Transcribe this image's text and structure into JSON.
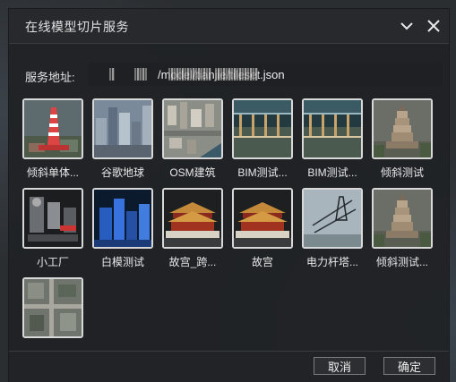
{
  "dialog": {
    "title": "在线模型切片服务",
    "collapse_icon": "chevron-down-icon",
    "close_icon": "close-icon"
  },
  "address": {
    "label": "服务地址:",
    "value": "/model/tianjie/tileset.json"
  },
  "services": [
    {
      "label": "倾斜单体...",
      "thumb": "tower-red"
    },
    {
      "label": "谷歌地球",
      "thumb": "city-blue"
    },
    {
      "label": "OSM建筑",
      "thumb": "osm-city"
    },
    {
      "label": "BIM测试...",
      "thumb": "bim-hall"
    },
    {
      "label": "BIM测试...",
      "thumb": "bim-hall"
    },
    {
      "label": "倾斜测试",
      "thumb": "pagoda"
    },
    {
      "label": "小工厂",
      "thumb": "factory"
    },
    {
      "label": "白模测试",
      "thumb": "white-model"
    },
    {
      "label": "故宫_跨...",
      "thumb": "palace"
    },
    {
      "label": "故宫",
      "thumb": "palace"
    },
    {
      "label": "电力杆塔...",
      "thumb": "power-tower"
    },
    {
      "label": "倾斜测试...",
      "thumb": "pagoda"
    },
    {
      "label": "",
      "thumb": "aerial"
    }
  ],
  "footer": {
    "cancel_label": "取消",
    "confirm_label": "确定"
  }
}
